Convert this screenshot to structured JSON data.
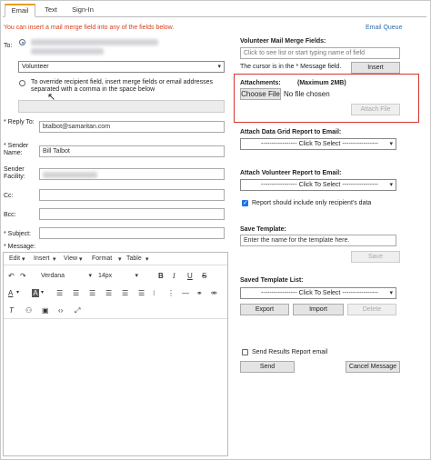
{
  "tabs": [
    {
      "label": "Email",
      "active": true
    },
    {
      "label": "Text",
      "active": false
    },
    {
      "label": "Sign-In",
      "active": false
    }
  ],
  "header": {
    "notice": "You can insert a mail merge field into any of the fields below.",
    "queue_link": "Email Queue"
  },
  "to": {
    "label": "To:",
    "radio_selected": true,
    "recipient_select": "Volunteer",
    "override_text": "To override recipient field, insert merge fields or email addresses separated with a comma in the space below"
  },
  "reply_to": {
    "label": "* Reply To:",
    "value": "btalbot@samaritan.com"
  },
  "sender_name": {
    "label": "* Sender Name:",
    "value": "Bill Talbot"
  },
  "sender_facility": {
    "label": "Sender Facility:"
  },
  "cc": {
    "label": "Cc:"
  },
  "bcc": {
    "label": "Bcc:"
  },
  "subject": {
    "label": "* Subject:"
  },
  "message": {
    "label": "* Message:",
    "menu": [
      "Edit",
      "Insert",
      "View",
      "Format",
      "Table"
    ],
    "font": "Verdana",
    "size": "14px"
  },
  "merge_fields": {
    "title": "Volunteer Mail Merge Fields:",
    "placeholder": "Click to see list or start typing name of field",
    "hint": "The cursor is in the * Message field.",
    "insert_label": "Insert"
  },
  "attachments": {
    "title": "Attachments:",
    "max": "(Maximum 2MB)",
    "choose_label": "Choose File",
    "no_file": "No file chosen",
    "attach_label": "Attach File"
  },
  "grid_report": {
    "title": "Attach Data Grid Report to Email:",
    "select": "----------------- Click To Select -----------------"
  },
  "volunteer_report": {
    "title": "Attach Volunteer Report to Email:",
    "select": "----------------- Click To Select -----------------",
    "checkbox_label": "Report should include only recipient's data",
    "checked": true
  },
  "save_template": {
    "title": "Save Template:",
    "placeholder": "Enter the name for the template here.",
    "save_label": "Save"
  },
  "saved_templates": {
    "title": "Saved Template List:",
    "select": "----------------- Click To Select -----------------",
    "export_label": "Export",
    "import_label": "Import",
    "delete_label": "Delete"
  },
  "send_results": {
    "label": "Send Results Report email",
    "checked": false
  },
  "actions": {
    "send_label": "Send",
    "cancel_label": "Cancel Message"
  },
  "colors": {
    "accent_tab": "#e8a020",
    "notice": "#d9401c",
    "link": "#2b6cb0",
    "highlight_box": "#d4342f",
    "check": "#1a73e8"
  }
}
